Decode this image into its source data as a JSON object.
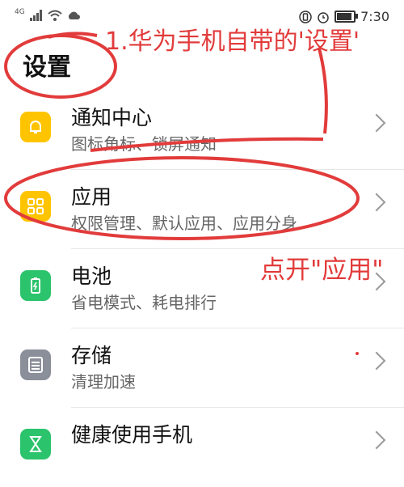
{
  "status_bar": {
    "network": "4G",
    "time": "7:30",
    "battery_level": 0.8
  },
  "page_title": "设置",
  "annotations": {
    "step1": "1.华为手机自带的'设置'",
    "step2": "点开\"应用\""
  },
  "settings_items": [
    {
      "label": "通知中心",
      "sub": "图标角标、锁屏通知",
      "icon": "bell-icon",
      "color": "#ffc400"
    },
    {
      "label": "应用",
      "sub": "权限管理、默认应用、应用分身",
      "icon": "apps-grid-icon",
      "color": "#ffc400"
    },
    {
      "label": "电池",
      "sub": "省电模式、耗电排行",
      "icon": "battery-icon",
      "color": "#2bc36b"
    },
    {
      "label": "存储",
      "sub": "清理加速",
      "icon": "storage-icon",
      "color": "#8a8f99"
    },
    {
      "label": "健康使用手机",
      "sub": "",
      "icon": "hourglass-icon",
      "color": "#2bc36b"
    }
  ],
  "colors": {
    "annotation": "#e23b3b"
  }
}
